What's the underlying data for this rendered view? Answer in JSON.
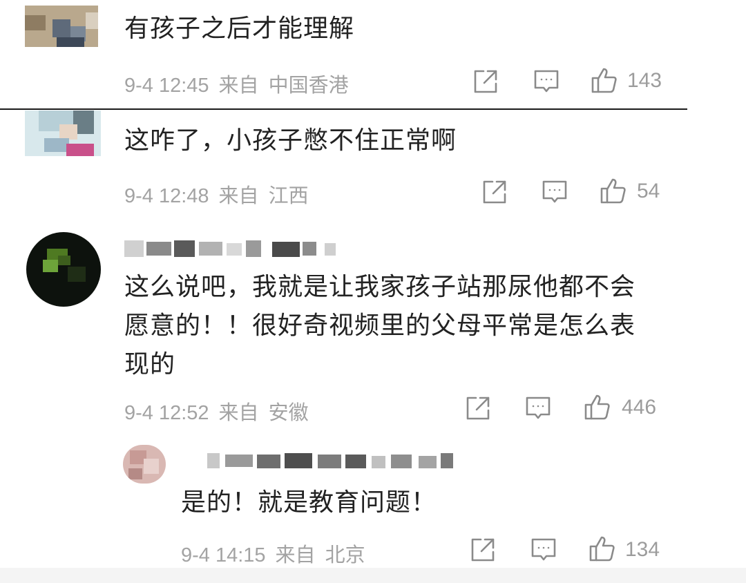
{
  "comments": [
    {
      "text": "有孩子之后才能理解",
      "date": "9-4 12:45",
      "from": "来自",
      "location": "中国香港",
      "likes": "143"
    },
    {
      "text": "这咋了，小孩子憋不住正常啊",
      "date": "9-4 12:48",
      "from": "来自",
      "location": "江西",
      "likes": "54"
    },
    {
      "text": "这么说吧，我就是让我家孩子站那尿他都不会\n愿意的！！很好奇视频里的父母平常是怎么表\n现的",
      "date": "9-4 12:52",
      "from": "来自",
      "location": "安徽",
      "likes": "446"
    }
  ],
  "reply": {
    "text": "是的！就是教育问题！",
    "date": "9-4 14:15",
    "from": "来自",
    "location": "北京",
    "likes": "134"
  },
  "icons": {
    "share": "share-icon",
    "comment": "comment-icon",
    "like": "thumbs-up-icon"
  }
}
